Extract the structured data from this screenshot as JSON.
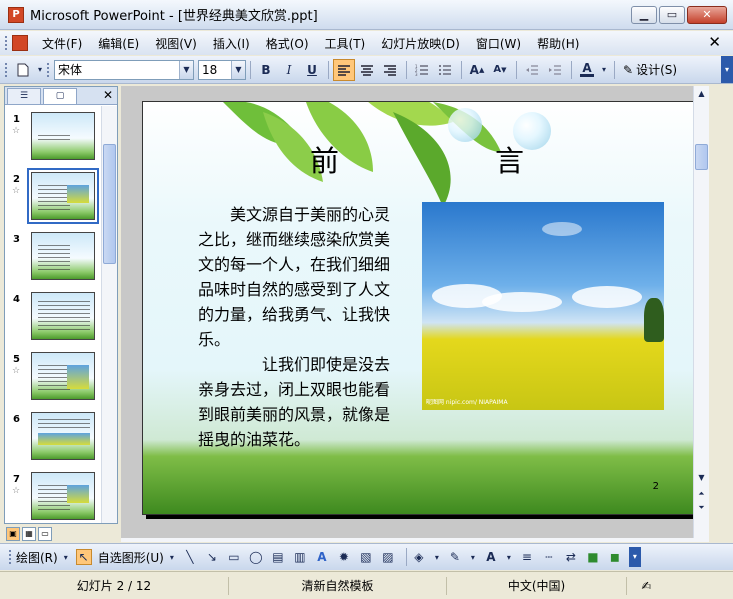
{
  "window": {
    "title": "Microsoft PowerPoint - [世界经典美文欣赏.ppt]",
    "app_icon_text": "P"
  },
  "menu": {
    "items": [
      "文件(F)",
      "编辑(E)",
      "视图(V)",
      "插入(I)",
      "格式(O)",
      "工具(T)",
      "幻灯片放映(D)",
      "窗口(W)",
      "帮助(H)"
    ]
  },
  "toolbar": {
    "font_name": "宋体",
    "font_size": "18",
    "bold": "B",
    "italic": "I",
    "underline": "U",
    "design_label": "设计(S)"
  },
  "left_pane": {
    "slides": [
      {
        "num": "1",
        "star": "☆"
      },
      {
        "num": "2",
        "star": "☆",
        "selected": true
      },
      {
        "num": "3",
        "star": ""
      },
      {
        "num": "4",
        "star": ""
      },
      {
        "num": "5",
        "star": "☆"
      },
      {
        "num": "6",
        "star": ""
      },
      {
        "num": "7",
        "star": "☆"
      }
    ]
  },
  "slide": {
    "title_left": "前",
    "title_right": "言",
    "paragraph1": "美文源自于美丽的心灵之比，继而继续感染欣赏美文的每一个人，在我们细细品味时自然的感受到了人文的力量，给我勇气、让我快乐。",
    "paragraph2": "让我们即使是没去亲身去过，闭上双眼也能看到眼前美丽的风景，就像是摇曳的油菜花。",
    "photo_caption": "昵图网 nipic.com/ NIAPAIMA",
    "number": "2"
  },
  "drawbar": {
    "draw_label": "绘图(R)",
    "autoshape_label": "自选图形(U)"
  },
  "status": {
    "slide_info": "幻灯片 2 / 12",
    "template": "清新自然模板",
    "language": "中文(中国)"
  }
}
